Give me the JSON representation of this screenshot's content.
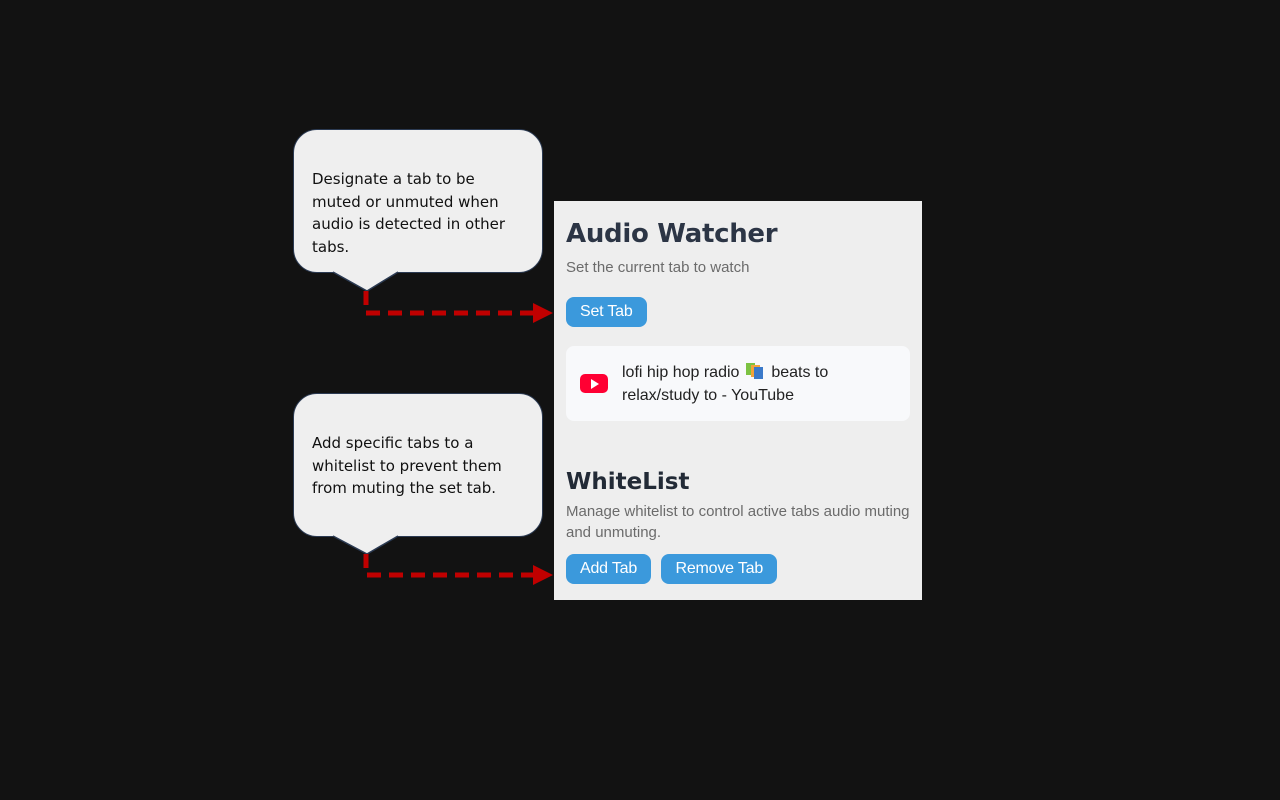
{
  "callouts": {
    "set_tab": "Designate a tab to be muted or unmuted when audio is detected in other tabs.",
    "whitelist": "Add specific tabs to a whitelist to prevent them from muting the set tab."
  },
  "panel": {
    "title": "Audio Watcher",
    "subtitle": "Set the current tab to watch",
    "set_tab_label": "Set Tab",
    "current_tab": {
      "icon": "youtube-icon",
      "title_part1": "lofi hip hop radio",
      "emoji": "books-emoji",
      "title_part2": "beats to relax/study to - YouTube"
    },
    "whitelist_title": "WhiteList",
    "whitelist_subtitle": "Manage whitelist to control active tabs audio muting and unmuting.",
    "add_tab_label": "Add Tab",
    "remove_tab_label": "Remove Tab"
  },
  "colors": {
    "background": "#121212",
    "button": "#3b99dc",
    "arrow": "#c00000",
    "callout_border": "#2b3a52"
  }
}
